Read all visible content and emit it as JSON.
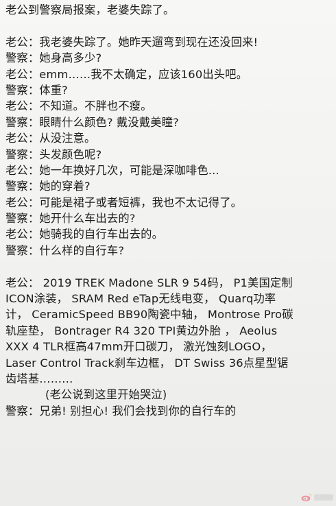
{
  "title": "老公到警察局报案，老婆失踪了。",
  "dialogue": [
    {
      "speaker": "老公：",
      "text": "我老婆失踪了。她昨天遛弯到现在还没回来!"
    },
    {
      "speaker": "警察：",
      "text": "她身高多少?"
    },
    {
      "speaker": "老公：",
      "text": "emm……我不太确定，应该160出头吧。"
    },
    {
      "speaker": "警察：",
      "text": "体重?"
    },
    {
      "speaker": "老公：",
      "text": "不知道。不胖也不瘦。"
    },
    {
      "speaker": "警察：",
      "text": "眼睛什么颜色? 戴没戴美瞳?"
    },
    {
      "speaker": "老公：",
      "text": "从没注意。"
    },
    {
      "speaker": "警察：",
      "text": "头发颜色呢?"
    },
    {
      "speaker": "老公：",
      "text": "她一年换好几次，可能是深咖啡色..."
    },
    {
      "speaker": "警察：",
      "text": "她的穿着?"
    },
    {
      "speaker": "老公：",
      "text": "可能是裙子或者短裤，我也不太记得了。"
    },
    {
      "speaker": "警察：",
      "text": "她开什么车出去的?"
    },
    {
      "speaker": "老公：",
      "text": "她骑我的自行车出去的。"
    },
    {
      "speaker": "警察：",
      "text": "什么样的自行车?"
    }
  ],
  "bike_paragraph": [
    "老公： 2019 TREK Madone SLR 9 54码， P1美国定制",
    "ICON涂装， SRAM Red eTap无线电变， Quarq功率",
    "计， CeramicSpeed BB90陶瓷中轴， Montrose Pro碳",
    "轨座垫， Bontrager R4 320 TPI黄边外胎 ， Aeolus",
    "XXX 4 TLR框高47mm开口碳刀， 激光蚀刻LOGO，",
    "Laser Control Track刹车边框， DT Swiss 36点星型锯",
    "齿塔基………"
  ],
  "stage_direction": "(老公说到这里开始哭泣)",
  "final_line": {
    "speaker": "警察：",
    "text": "兄弟! 别担心! 我们会找到你的自行车的"
  },
  "watermark_icon": "weibo-logo-icon",
  "colors": {
    "text": "#1c1c1c",
    "background": "#f4f4f2",
    "weibo": "#e6162d"
  }
}
